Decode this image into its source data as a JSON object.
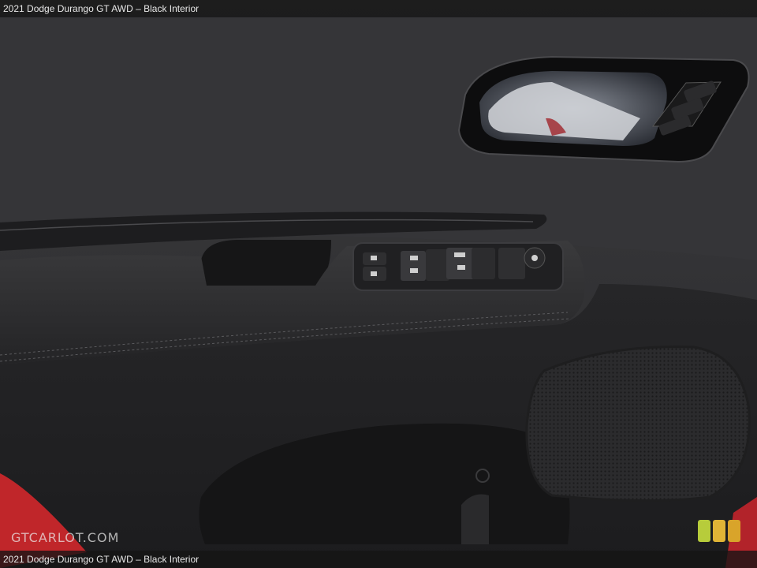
{
  "caption": {
    "top": "2021 Dodge Durango GT AWD – Black Interior",
    "bottom": "2021 Dodge Durango GT AWD – Black Interior"
  },
  "watermark": "GTCARLOT.COM",
  "rating": {
    "level": 3,
    "max": 3,
    "colors": [
      "#b7cc3b",
      "#e0b436",
      "#d9a42a"
    ]
  },
  "photo": {
    "subject": "door-panel",
    "door_color": "#1f1f21",
    "exterior_color": "#c0262a"
  }
}
